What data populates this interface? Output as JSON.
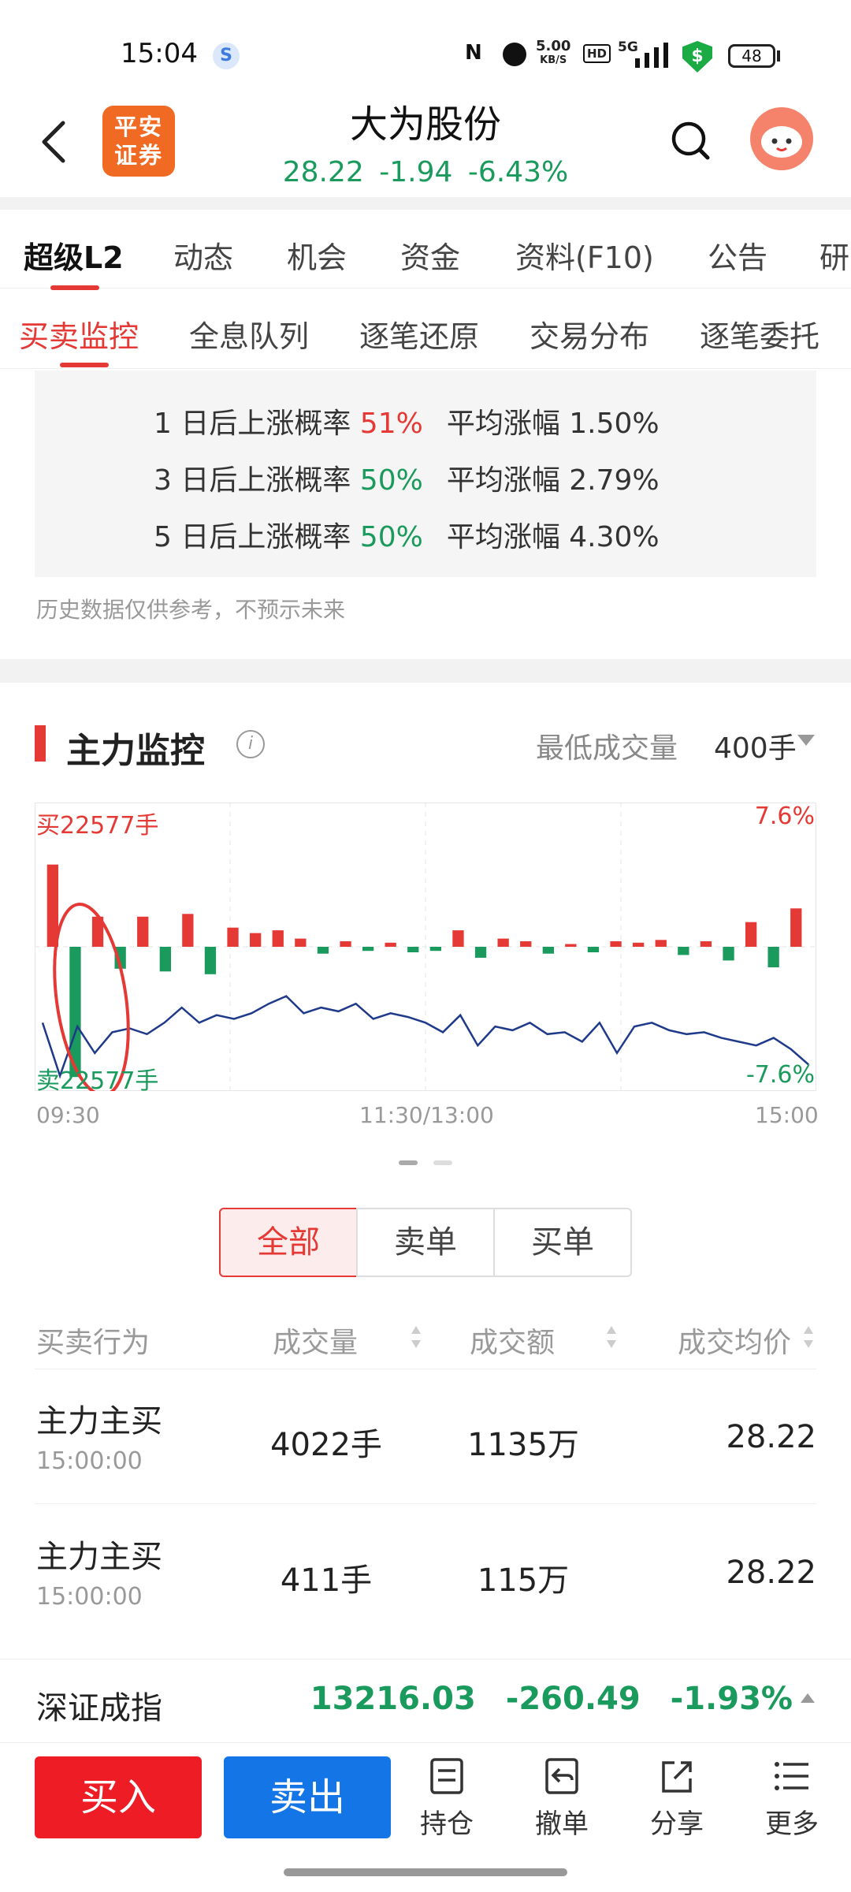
{
  "status": {
    "time": "15:04",
    "net_speed": "5.00",
    "net_unit": "KB/S",
    "hd": "HD",
    "signal": "5G",
    "battery": "48"
  },
  "header": {
    "broker_logo": "平安\n证券",
    "stock_name": "大为股份",
    "price": "28.22",
    "change": "-1.94",
    "change_pct": "-6.43%"
  },
  "tabs_main": [
    "超级L2",
    "动态",
    "机会",
    "资金",
    "资料(F10)",
    "公告",
    "研"
  ],
  "tabs_sub": [
    "买卖监控",
    "全息队列",
    "逐笔还原",
    "交易分布",
    "逐笔委托"
  ],
  "stats": [
    {
      "prefix": "1 日后上涨概率 ",
      "prob": "51%",
      "prob_color": "red",
      "avg_label": "平均涨幅 ",
      "avg": "1.50%"
    },
    {
      "prefix": "3 日后上涨概率 ",
      "prob": "50%",
      "prob_color": "green",
      "avg_label": "平均涨幅 ",
      "avg": "2.79%"
    },
    {
      "prefix": "5 日后上涨概率 ",
      "prob": "50%",
      "prob_color": "green",
      "avg_label": "平均涨幅 ",
      "avg": "4.30%"
    }
  ],
  "disclaimer": "历史数据仅供参考，不预示未来",
  "monitor": {
    "title": "主力监控",
    "min_volume_label": "最低成交量",
    "min_volume_value": "400手",
    "buy_max_label": "买22577手",
    "sell_max_label": "卖22577手",
    "pct_top": "7.6%",
    "pct_bottom": "-7.6%",
    "x_labels": [
      "09:30",
      "11:30/13:00",
      "15:00"
    ]
  },
  "chart_data": {
    "type": "bar+line",
    "x": [
      "09:30",
      "11:30/13:00",
      "15:00"
    ],
    "ylim_percent": [
      -7.6,
      7.6
    ],
    "volume_max_lots": 22577,
    "series": [
      {
        "kind": "bar",
        "values": [
          0.6,
          -0.95,
          0.22,
          -0.16,
          0.22,
          -0.18,
          0.24,
          -0.2,
          0.14,
          0.1,
          0.12,
          0.06,
          -0.05,
          0.04,
          -0.03,
          0.03,
          -0.04,
          -0.03,
          0.12,
          -0.08,
          0.06,
          0.04,
          -0.05,
          0.02,
          -0.04,
          0.04,
          0.03,
          0.05,
          -0.06,
          0.04,
          -0.1,
          0.18,
          -0.15,
          0.28
        ]
      },
      {
        "kind": "line",
        "values": [
          -4.0,
          -6.8,
          -4.2,
          -5.6,
          -4.5,
          -4.3,
          -4.6,
          -4.0,
          -3.2,
          -4.0,
          -3.6,
          -3.8,
          -3.5,
          -3.0,
          -2.6,
          -3.5,
          -3.2,
          -3.4,
          -3.0,
          -3.8,
          -3.5,
          -3.7,
          -4.0,
          -4.5,
          -3.6,
          -5.2,
          -4.2,
          -4.4,
          -4.0,
          -4.6,
          -4.5,
          -5.0,
          -4.0,
          -5.6,
          -4.2,
          -4.0,
          -4.4,
          -4.6,
          -4.5,
          -4.8,
          -5.0,
          -5.2,
          -4.8,
          -5.4,
          -6.2
        ]
      }
    ]
  },
  "filter": {
    "all": "全部",
    "sell": "卖单",
    "buy": "买单"
  },
  "table": {
    "headers": [
      "买卖行为",
      "成交量",
      "成交额",
      "成交均价"
    ],
    "rows": [
      {
        "action": "主力主买",
        "time": "15:00:00",
        "volume": "4022手",
        "amount": "1135万",
        "price": "28.22"
      },
      {
        "action": "主力主买",
        "time": "15:00:00",
        "volume": "411手",
        "amount": "115万",
        "price": "28.22"
      }
    ]
  },
  "index": {
    "name": "深证成指",
    "value": "13216.03",
    "change": "-260.49",
    "change_pct": "-1.93%"
  },
  "bottom": {
    "buy": "买入",
    "sell": "卖出",
    "actions": [
      "持仓",
      "撤单",
      "分享",
      "更多"
    ]
  },
  "colors": {
    "up_red": "#e53935",
    "down_green": "#1a9a5c",
    "buy_btn": "#ee1c24",
    "sell_btn": "#1475e6",
    "line": "#1f3a8a"
  }
}
